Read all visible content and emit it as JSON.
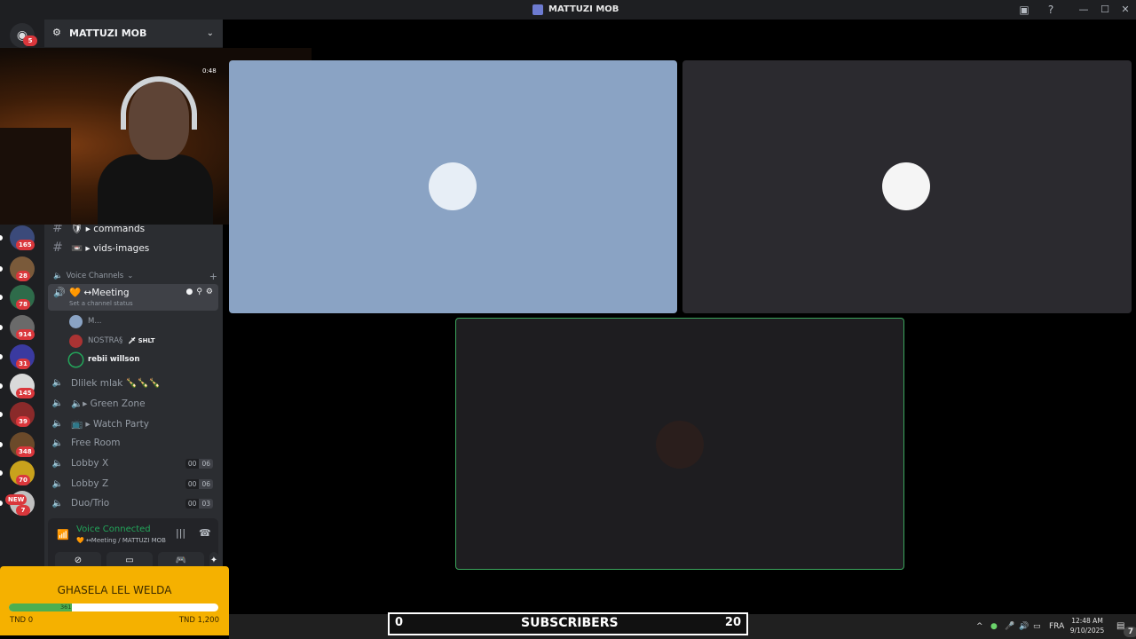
{
  "window": {
    "title": "MATTUZI MOB"
  },
  "rail": {
    "home_badge": "5",
    "servers": [
      {
        "badge": "165",
        "color": "#3b4a7a"
      },
      {
        "badge": "28",
        "color": "#7a5a3a"
      },
      {
        "badge": "78",
        "color": "#2e6b4a"
      },
      {
        "badge": "914",
        "color": "#6a6a6a"
      },
      {
        "badge": "31",
        "color": "#3a3aa0"
      },
      {
        "badge": "145",
        "color": "#d9d9d9"
      },
      {
        "badge": "39",
        "color": "#8a2a2a"
      },
      {
        "badge": "348",
        "color": "#6b4a2a"
      },
      {
        "badge": "70",
        "color": "#c9a21c"
      },
      {
        "badge": "7",
        "color": "#c0c0c0",
        "tag": "NEW"
      }
    ]
  },
  "sidebar": {
    "server_name": "MATTUZI MOB",
    "text_channels": [
      {
        "name": "🛡 ▸ commands"
      },
      {
        "name": "📼 ▸ vids-images"
      }
    ],
    "voice_category": "Voice Channels",
    "meeting": {
      "name": "🧡 ↔Meeting",
      "status": "Set a channel status"
    },
    "voice_users": [
      {
        "name": "M..."
      },
      {
        "name": "NOSTRA§",
        "tag": "🗡 SHLT"
      },
      {
        "name": "rebii willson"
      }
    ],
    "voice_channels": [
      {
        "name": "Dlilek mlak 🍾🍾🍾"
      },
      {
        "name": "🔈▸ Green Zone"
      },
      {
        "name": "📺 ▸ Watch Party"
      },
      {
        "name": "Free Room"
      },
      {
        "name": "Lobby X",
        "limit_a": "00",
        "limit_b": "06"
      },
      {
        "name": "Lobby Z",
        "limit_a": "00",
        "limit_b": "06"
      },
      {
        "name": "Duo/Trio",
        "limit_a": "00",
        "limit_b": "03"
      }
    ],
    "voice_panel": {
      "status": "Voice Connected",
      "location": "🧡 ↔Meeting / MATTUZI MOB"
    }
  },
  "webcam": {
    "timestamp": "0:48"
  },
  "donation": {
    "title": "GHASELA LEL WELDA",
    "progress_label": "361",
    "progress_fraction": 0.3,
    "min_label": "TND 0",
    "max_label": "TND 1,200"
  },
  "subscribers": {
    "left_value": "0",
    "label": "SUBSCRIBERS",
    "count": "20"
  },
  "taskbar": {
    "language": "FRA",
    "time": "12:48 AM",
    "date": "9/10/2025",
    "notif_count": "7"
  }
}
